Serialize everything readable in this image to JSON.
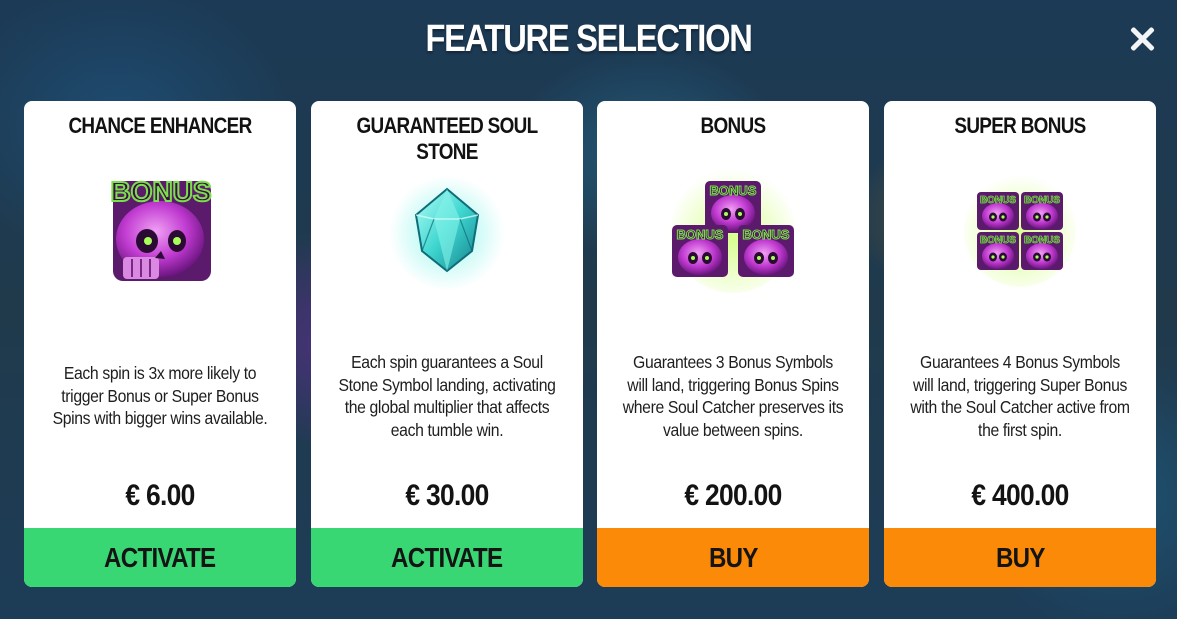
{
  "header": {
    "title": "FEATURE SELECTION"
  },
  "close": {
    "icon": "close-icon"
  },
  "colors": {
    "activate": "#39d674",
    "buy": "#fb8a09",
    "skull": "#c03ad0",
    "gem": "#3fd6d0"
  },
  "cards": [
    {
      "title": "CHANCE ENHANCER",
      "icon": "bonus-skull-icon",
      "description": "Each spin is 3x more likely to trigger Bonus or Super Bonus Spins with bigger wins available.",
      "price": "€ 6.00",
      "button": "ACTIVATE"
    },
    {
      "title": "GUARANTEED SOUL STONE",
      "icon": "soul-stone-gem-icon",
      "description": "Each spin guarantees a Soul Stone Symbol landing, activating the global multiplier that affects each tumble win.",
      "price": "€ 30.00",
      "button": "ACTIVATE"
    },
    {
      "title": "BONUS",
      "icon": "three-bonus-skulls-icon",
      "description": "Guarantees 3 Bonus Symbols will land, triggering Bonus Spins where Soul Catcher preserves its value between spins.",
      "price": "€ 200.00",
      "button": "BUY"
    },
    {
      "title": "SUPER BONUS",
      "icon": "four-bonus-skulls-icon",
      "description": "Guarantees 4 Bonus Symbols will land, triggering Super Bonus with the Soul Catcher active from the first spin.",
      "price": "€ 400.00",
      "button": "BUY"
    }
  ],
  "symbol_text": "BONUS"
}
